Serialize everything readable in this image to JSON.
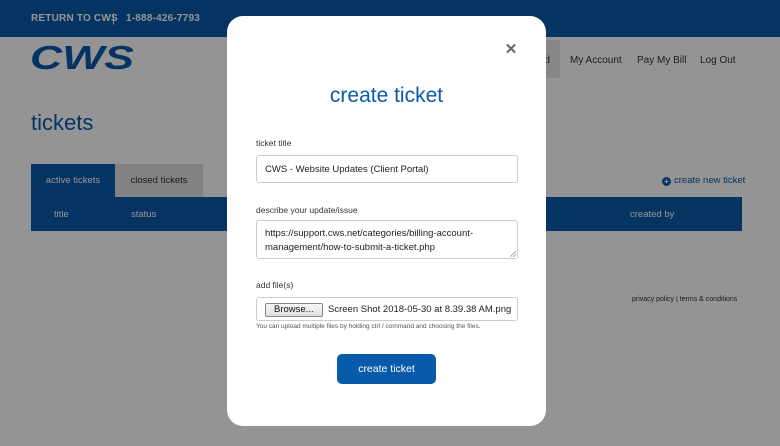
{
  "topbar": {
    "return_label": "RETURN TO CWS",
    "separator": "|",
    "phone": "1-888-426-7793"
  },
  "brand": {
    "logo_text": "CWS",
    "color": "#0a5aab"
  },
  "nav": {
    "partial_label": "d",
    "account_label": "My Account",
    "bill_label": "Pay My Bill",
    "logout_label": "Log Out"
  },
  "page": {
    "title": "tickets",
    "tabs": [
      {
        "label": "active tickets",
        "active": true
      },
      {
        "label": "closed tickets",
        "active": false
      }
    ],
    "create_link": "create new ticket",
    "table_headers": {
      "title": "title",
      "status": "status",
      "created_by": "created by"
    },
    "footer": "privacy policy | terms & conditions"
  },
  "modal": {
    "title": "create ticket",
    "close_icon": "close-icon",
    "fields": {
      "title_label": "ticket title",
      "title_value": "CWS - Website Updates (Client Portal)",
      "desc_label": "describe your update/issue",
      "desc_value": "https://support.cws.net/categories/billing-account-management/how-to-submit-a-ticket.php",
      "files_label": "add file(s)",
      "browse_label": "Browse...",
      "file_name": "Screen Shot 2018-05-30 at 8.39.38 AM.png",
      "files_hint": "You can upload multiple files by holding ctrl / command and choosing the files."
    },
    "submit_label": "create ticket"
  }
}
